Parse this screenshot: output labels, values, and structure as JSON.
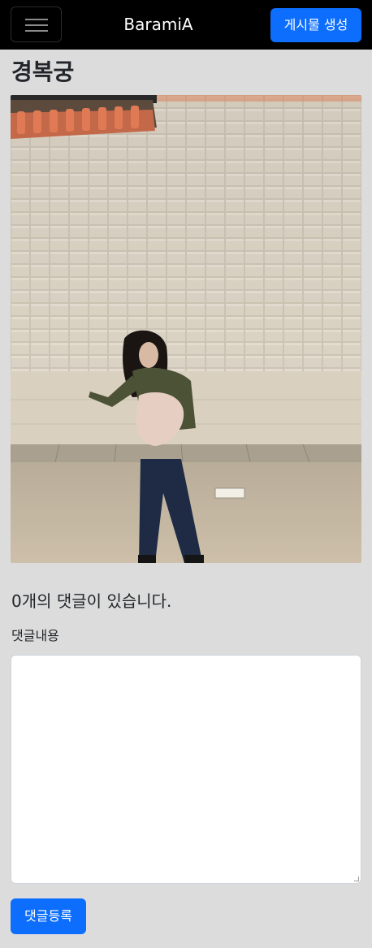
{
  "navbar": {
    "brand": "BaramiA",
    "create_post_label": "게시물 생성",
    "menu_icon": "hamburger-menu-icon"
  },
  "post": {
    "title": "경복궁",
    "photo_description": "Woman dancing at night in front of a lit stone palace wall with a tiled roof"
  },
  "comments": {
    "count_text": "0개의 댓글이 있습니다.",
    "content_label": "댓글내용",
    "content_value": "",
    "submit_label": "댓글등록"
  },
  "colors": {
    "primary": "#0d6efd",
    "navbar": "#000000",
    "background": "#dcdcdc"
  }
}
